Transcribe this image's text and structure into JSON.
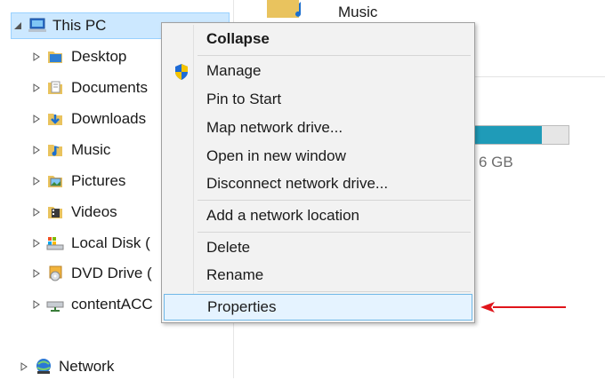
{
  "nav": {
    "items": [
      {
        "label": "This PC",
        "icon": "this-pc-icon",
        "expanded": true
      },
      {
        "label": "Desktop",
        "icon": "desktop-folder-icon"
      },
      {
        "label": "Documents",
        "icon": "documents-folder-icon"
      },
      {
        "label": "Downloads",
        "icon": "downloads-folder-icon"
      },
      {
        "label": "Music",
        "icon": "music-folder-icon"
      },
      {
        "label": "Pictures",
        "icon": "pictures-folder-icon"
      },
      {
        "label": "Videos",
        "icon": "videos-folder-icon"
      },
      {
        "label": "Local Disk (",
        "icon": "local-disk-icon"
      },
      {
        "label": "DVD Drive (",
        "icon": "dvd-drive-icon"
      },
      {
        "label": "contentACC",
        "icon": "network-drive-icon"
      },
      {
        "label": "Network",
        "icon": "network-icon"
      }
    ]
  },
  "content": {
    "music_tile_label": "Music",
    "drive_free_text": "6 GB",
    "drive_used_fraction": 0.72
  },
  "context_menu": {
    "items": [
      {
        "label": "Collapse",
        "bold": true
      },
      {
        "label": "Manage",
        "icon": "uac-shield-icon"
      },
      {
        "label": "Pin to Start"
      },
      {
        "label": "Map network drive..."
      },
      {
        "label": "Open in new window"
      },
      {
        "label": "Disconnect network drive..."
      },
      {
        "label": "Add a network location"
      },
      {
        "label": "Delete"
      },
      {
        "label": "Rename"
      },
      {
        "label": "Properties",
        "highlighted": true
      }
    ]
  },
  "annotation": {
    "arrow_color": "#e0151b",
    "points_to": "Properties"
  },
  "colors": {
    "selection_bg": "#cce8ff",
    "menu_bg": "#f2f2f2",
    "menu_highlight": "#e5f3ff",
    "drive_bar": "#1f9bb8"
  }
}
